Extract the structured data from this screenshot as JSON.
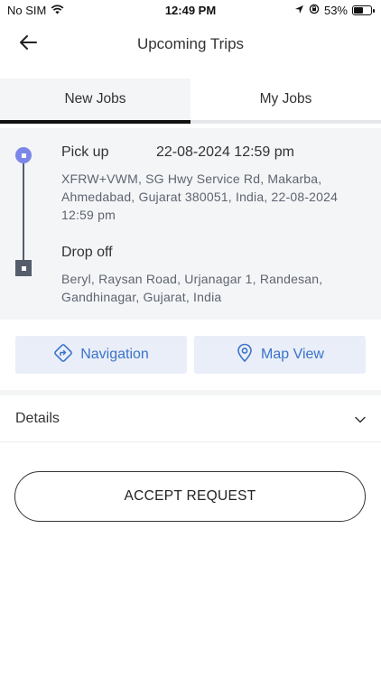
{
  "status_bar": {
    "carrier": "No SIM",
    "time": "12:49 PM",
    "battery": "53%",
    "battery_level": 0.53
  },
  "header": {
    "title": "Upcoming Trips"
  },
  "tabs": [
    {
      "label": "New Jobs",
      "active": true
    },
    {
      "label": "My Jobs",
      "active": false
    }
  ],
  "trip": {
    "pickup_label": "Pick up",
    "pickup_time": "22-08-2024 12:59 pm",
    "pickup_address": "XFRW+VWM, SG Hwy Service Rd, Makarba, Ahmedabad, Gujarat 380051, India, 22-08-2024 12:59 pm",
    "drop_label": "Drop off",
    "drop_address": "Beryl, Raysan Road, Urjanagar 1, Randesan, Gandhinagar, Gujarat, India"
  },
  "actions": {
    "navigation_label": "Navigation",
    "map_view_label": "Map View"
  },
  "details": {
    "label": "Details"
  },
  "accept_button": {
    "label": "ACCEPT REQUEST"
  },
  "colors": {
    "accent_blue": "#3b73c9",
    "pickup_dot": "#7b86e8",
    "route": "#555d6b",
    "card_bg": "#f4f5f7",
    "button_bg": "#e9eef8"
  }
}
